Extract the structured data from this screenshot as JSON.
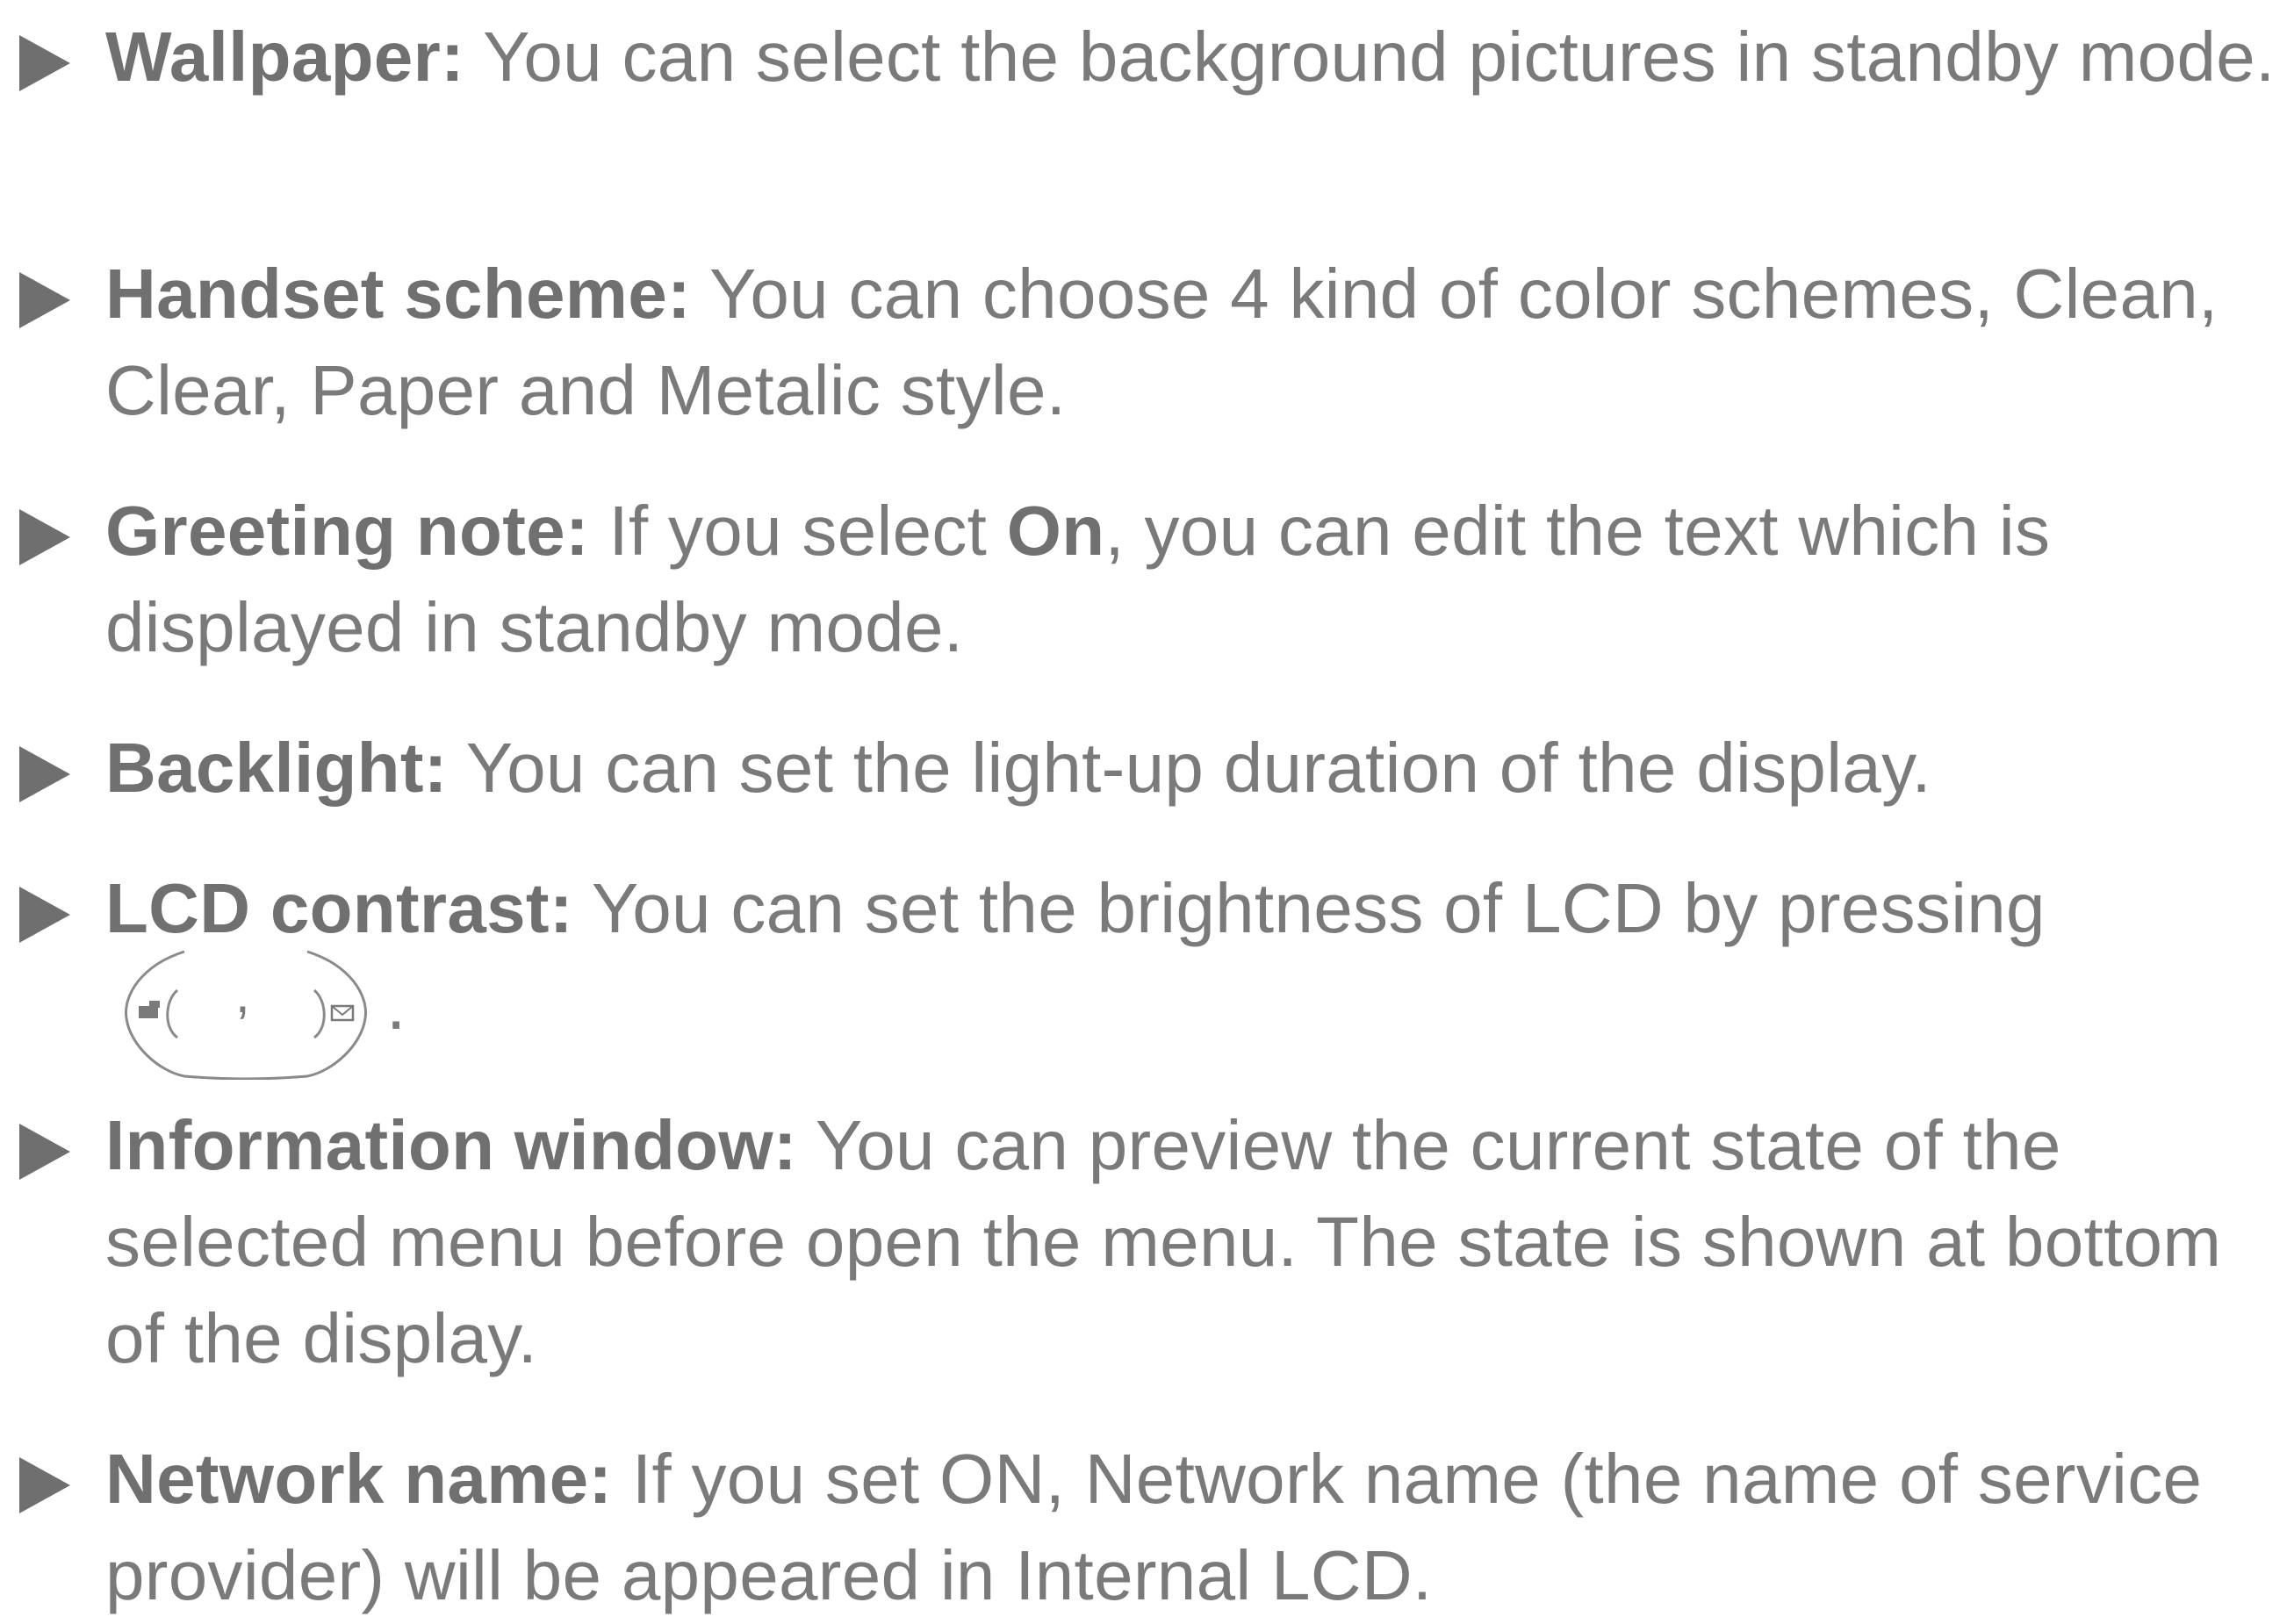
{
  "items": [
    {
      "term": "Wallpaper:",
      "text": " You can select the background pictures in standby mode."
    },
    {
      "term": "Handset scheme:",
      "text": " You can choose 4 kind of color schemes, Clean, Clear, Paper and Metalic style."
    },
    {
      "term": "Greeting note:",
      "text_before": " If you select ",
      "strong": "On",
      "text_after": ", you can edit the text which is displayed in standby mode."
    },
    {
      "term": "Backlight:",
      "text": " You can set the light-up duration of the display."
    },
    {
      "term": "LCD contrast:",
      "text": " You can set the brightness of LCD by pressing",
      "key_separator": ",",
      "key_end": "."
    },
    {
      "term": "Information window:",
      "text": " You can preview the current state of the selected menu before open the menu. The state is shown at bottom of the display."
    },
    {
      "term": "Network name:",
      "text": " If you set ON, Network name (the name of service provider) will be appeared in Internal LCD."
    }
  ]
}
